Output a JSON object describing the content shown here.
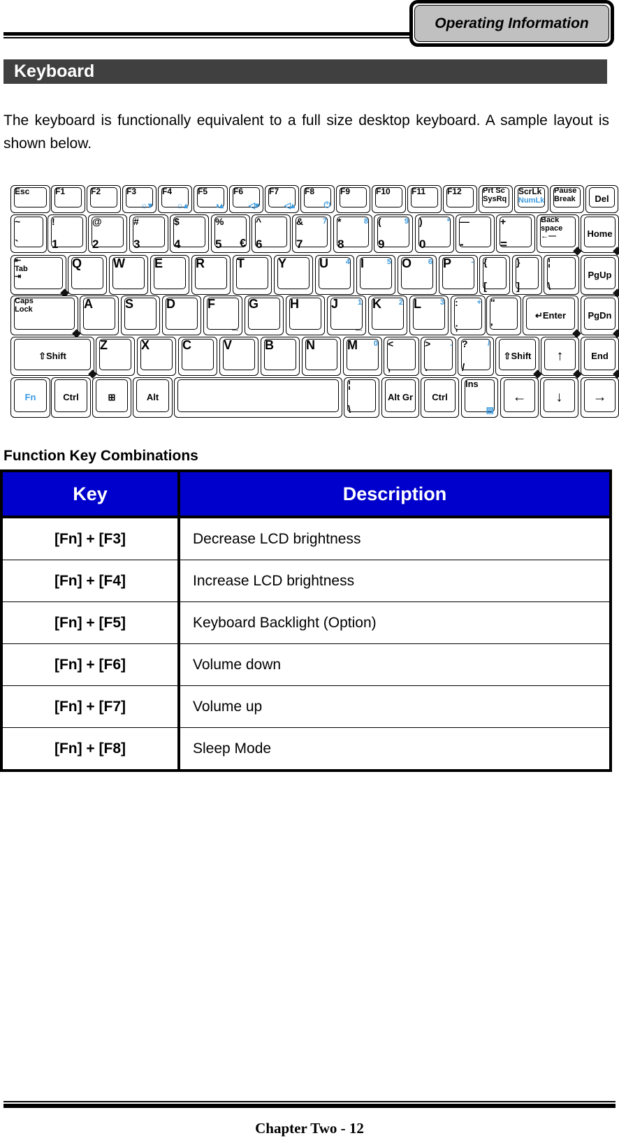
{
  "header": {
    "chapter_tab": "Operating Information"
  },
  "section": {
    "title": "Keyboard"
  },
  "intro": "The keyboard is functionally equivalent to a full size desktop keyboard. A sample layout is shown below.",
  "keyboard": {
    "fn_color": "#3b9be0",
    "rows": [
      [
        {
          "t": "Esc"
        },
        {
          "t": "F1"
        },
        {
          "t": "F2"
        },
        {
          "t": "F3",
          "fb": "☼▾",
          "icon": "brightness-down-icon"
        },
        {
          "t": "F4",
          "fb": "☼▴",
          "icon": "brightness-up-icon"
        },
        {
          "t": "F5",
          "fb": "◑▴",
          "icon": "backlight-icon"
        },
        {
          "t": "F6",
          "fb": "◁▾",
          "icon": "volume-down-icon"
        },
        {
          "t": "F7",
          "fb": "◁▴",
          "icon": "volume-up-icon"
        },
        {
          "t": "F8",
          "fb": "⏻",
          "icon": "sleep-power-icon"
        },
        {
          "t": "F9"
        },
        {
          "t": "F10"
        },
        {
          "t": "F11"
        },
        {
          "t": "F12"
        },
        {
          "t": "Prt Sc\nSysRq"
        },
        {
          "t": "ScrLk",
          "tf": "NumLk"
        },
        {
          "t": "Pause\nBreak"
        },
        {
          "c": "Del"
        }
      ],
      [
        {
          "t": "~",
          "b": "`"
        },
        {
          "t": "!",
          "b": "1"
        },
        {
          "t": "@",
          "b": "2"
        },
        {
          "t": "#",
          "b": "3"
        },
        {
          "t": "$",
          "b": "4"
        },
        {
          "t": "%",
          "b": "5",
          "e": "€"
        },
        {
          "t": "^",
          "b": "6"
        },
        {
          "t": "&",
          "b": "7",
          "f": "7"
        },
        {
          "t": "*",
          "b": "8",
          "f": "8"
        },
        {
          "t": "(",
          "b": "9",
          "f": "9"
        },
        {
          "t": ")",
          "b": "0",
          "f": "*"
        },
        {
          "t": "—",
          "b": "-"
        },
        {
          "t": "+",
          "b": "="
        },
        {
          "t": "Back\nspace\n←—"
        },
        {
          "c": "Home"
        }
      ],
      [
        {
          "t": "⇤\nTab\n⇥"
        },
        {
          "t": "Q"
        },
        {
          "t": "W"
        },
        {
          "t": "E"
        },
        {
          "t": "R"
        },
        {
          "t": "T"
        },
        {
          "t": "Y"
        },
        {
          "t": "U",
          "f": "4"
        },
        {
          "t": "I",
          "f": "5"
        },
        {
          "t": "O",
          "f": "6"
        },
        {
          "t": "P",
          "f": "-"
        },
        {
          "t": "{",
          "b": "["
        },
        {
          "t": "}",
          "b": "]"
        },
        {
          "t": "¦",
          "b": "\\"
        },
        {
          "c": "PgUp"
        }
      ],
      [
        {
          "t": "Caps\nLock"
        },
        {
          "t": "A"
        },
        {
          "t": "S"
        },
        {
          "t": "D"
        },
        {
          "t": "F",
          "e": "_"
        },
        {
          "t": "G"
        },
        {
          "t": "H"
        },
        {
          "t": "J",
          "f": "1",
          "e": "_"
        },
        {
          "t": "K",
          "f": "2"
        },
        {
          "t": "L",
          "f": "3"
        },
        {
          "t": ":",
          "b": ";",
          "f": "+"
        },
        {
          "t": "\"",
          "b": "'"
        },
        {
          "c": "↵Enter"
        },
        {
          "c": "PgDn"
        }
      ],
      [
        {
          "c": "⇧Shift"
        },
        {
          "t": "Z"
        },
        {
          "t": "X"
        },
        {
          "t": "C"
        },
        {
          "t": "V"
        },
        {
          "t": "B"
        },
        {
          "t": "N"
        },
        {
          "t": "M",
          "f": "0"
        },
        {
          "t": "<",
          "b": ","
        },
        {
          "t": ">",
          "b": ".",
          "f": "."
        },
        {
          "t": "?",
          "b": "/",
          "f": "/"
        },
        {
          "c": "⇧Shift"
        },
        {
          "c": "↑"
        },
        {
          "c": "End"
        }
      ],
      [
        {
          "cf": "Fn"
        },
        {
          "c": "Ctrl"
        },
        {
          "c": "⊞",
          "icon": "windows-logo-icon"
        },
        {
          "c": "Alt"
        },
        {
          "c": ""
        },
        {
          "t": "¦",
          "b": "\\"
        },
        {
          "c": "Alt Gr"
        },
        {
          "c": "Ctrl"
        },
        {
          "t": "Ins",
          "fb": "▤",
          "icon": "menu-icon"
        },
        {
          "c": "←"
        },
        {
          "c": "↓"
        },
        {
          "c": "→"
        }
      ]
    ]
  },
  "function_keys": {
    "title": "Function Key Combinations",
    "header_color": "#0000cc",
    "columns": [
      "Key",
      "Description"
    ],
    "rows": [
      {
        "key": "[Fn] + [F3]",
        "description": "Decrease LCD brightness"
      },
      {
        "key": "[Fn] + [F4]",
        "description": "Increase LCD brightness"
      },
      {
        "key": "[Fn] + [F5]",
        "description": "Keyboard Backlight (Option)"
      },
      {
        "key": "[Fn] + [F6]",
        "description": "Volume down"
      },
      {
        "key": "[Fn] + [F7]",
        "description": "Volume up"
      },
      {
        "key": "[Fn] + [F8]",
        "description": "Sleep Mode"
      }
    ]
  },
  "footer": {
    "page_label": "Chapter Two - 12"
  }
}
